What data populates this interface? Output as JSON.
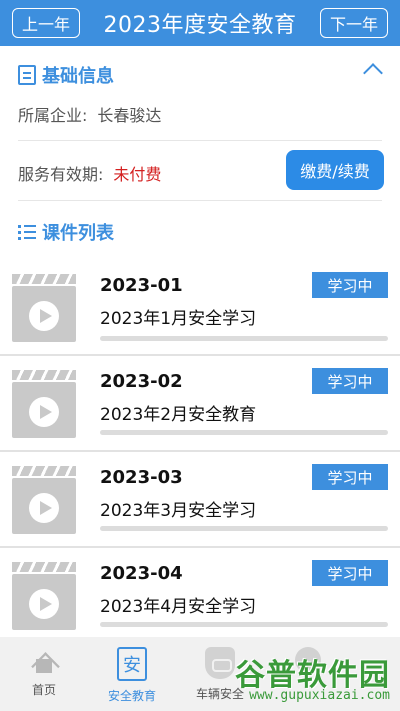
{
  "header": {
    "prev_label": "上一年",
    "title": "2023年度安全教育",
    "next_label": "下一年"
  },
  "basic_info": {
    "title": "基础信息",
    "company_label": "所属企业:",
    "company_value": "长春骏达",
    "service_label": "服务有效期:",
    "service_value": "未付费",
    "pay_button": "缴费/续费"
  },
  "course_list": {
    "title": "课件列表",
    "items": [
      {
        "code": "2023-01",
        "title": "2023年1月安全学习",
        "status": "学习中",
        "progress": 0
      },
      {
        "code": "2023-02",
        "title": "2023年2月安全教育",
        "status": "学习中",
        "progress": 0
      },
      {
        "code": "2023-03",
        "title": "2023年3月安全学习",
        "status": "学习中",
        "progress": 0
      },
      {
        "code": "2023-04",
        "title": "2023年4月安全学习",
        "status": "学习中",
        "progress": 0
      }
    ]
  },
  "tabbar": {
    "items": [
      {
        "label": "首页",
        "icon": "home-icon"
      },
      {
        "label": "安全教育",
        "icon": "safety-education-icon",
        "active": true
      },
      {
        "label": "车辆安全",
        "icon": "vehicle-safety-icon"
      },
      {
        "label": "",
        "icon": "generic-icon"
      }
    ]
  },
  "watermark": {
    "name": "谷普软件园",
    "url": "www.gupuxiazai.com"
  },
  "colors": {
    "primary": "#3d8fde",
    "unpaid": "#d42020"
  }
}
